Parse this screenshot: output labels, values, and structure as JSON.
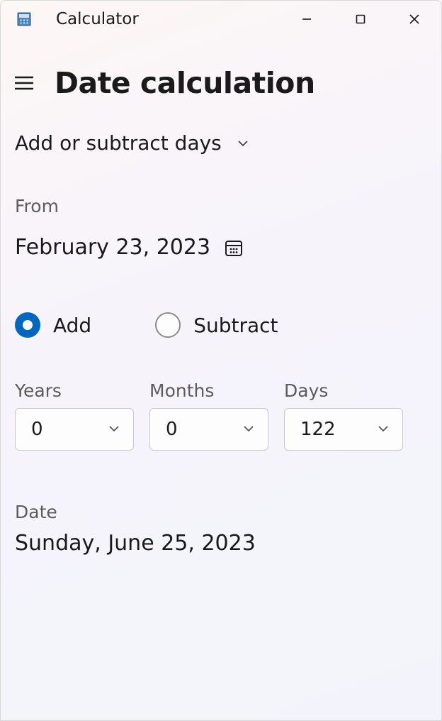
{
  "titlebar": {
    "app_title": "Calculator"
  },
  "header": {
    "page_title": "Date calculation"
  },
  "mode": {
    "label": "Add or subtract days"
  },
  "from": {
    "label": "From",
    "date": "February 23, 2023"
  },
  "operation": {
    "add_label": "Add",
    "subtract_label": "Subtract",
    "selected": "add"
  },
  "offset": {
    "years_label": "Years",
    "years_value": "0",
    "months_label": "Months",
    "months_value": "0",
    "days_label": "Days",
    "days_value": "122"
  },
  "result": {
    "label": "Date",
    "date": "Sunday, June 25, 2023"
  }
}
